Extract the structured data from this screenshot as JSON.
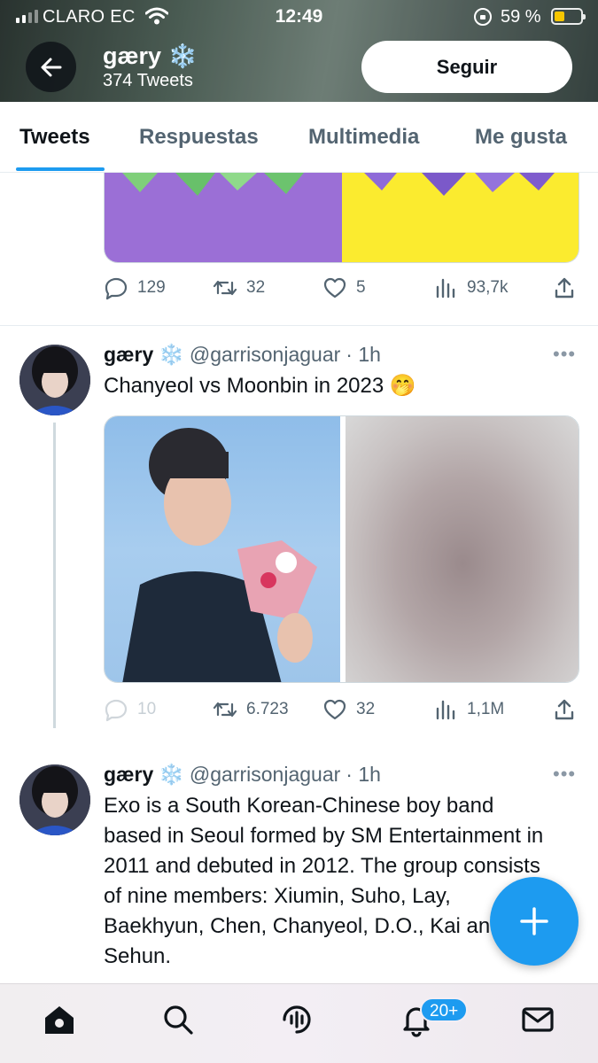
{
  "status_bar": {
    "carrier": "CLARO EC",
    "time": "12:49",
    "battery_percent": "59 %"
  },
  "header": {
    "name": "gæry",
    "name_emoji": "❄️",
    "tweet_count": "374 Tweets",
    "follow_label": "Seguir"
  },
  "tabs": [
    {
      "label": "Tweets",
      "active": true
    },
    {
      "label": "Respuestas",
      "active": false
    },
    {
      "label": "Multimedia",
      "active": false
    },
    {
      "label": "Me gusta",
      "active": false
    }
  ],
  "previous_tweet": {
    "replies": "129",
    "retweets": "32",
    "likes": "5",
    "views": "93,7k"
  },
  "tweets": [
    {
      "name": "gæry",
      "emoji": "❄️",
      "handle": "@garrisonjaguar",
      "time": "· 1h",
      "text": "Chanyeol vs Moonbin in 2023 🤭",
      "replies": "10",
      "retweets": "6.723",
      "likes": "32",
      "views": "1,1M"
    },
    {
      "name": "gæry",
      "emoji": "❄️",
      "handle": "@garrisonjaguar",
      "time": "· 1h",
      "text": "Exo is a South Korean-Chinese boy band based in Seoul formed by SM Entertainment in 2011 and debuted in 2012. The group consists of nine members: Xiumin, Suho, Lay, Baekhyun, Chen, Chanyeol, D.O., Kai and Sehun."
    }
  ],
  "fab_icon": "plus-icon",
  "notifications_badge": "20+",
  "colors": {
    "accent": "#1d9bf0",
    "text_primary": "#0f1419",
    "text_secondary": "#536471"
  }
}
